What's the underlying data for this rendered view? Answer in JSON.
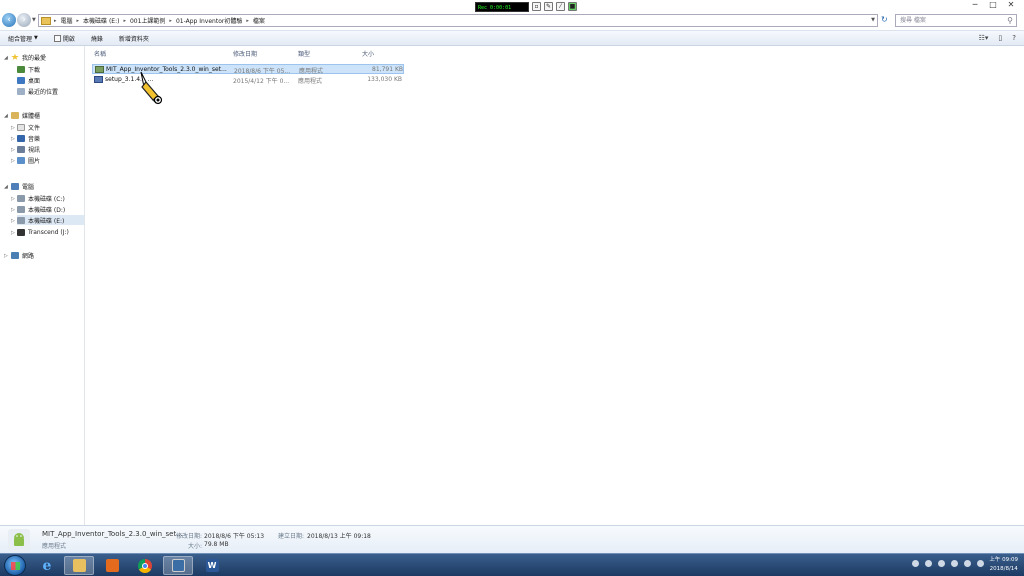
{
  "recorder": {
    "status": "Rec 0:00:01"
  },
  "window": {
    "min": "─",
    "max": "□",
    "close": "✕"
  },
  "address": {
    "crumbs": [
      "電腦",
      "本機磁碟 (E:)",
      "001上課範例",
      "01-App Inventor初體驗",
      "檔案"
    ],
    "search_placeholder": "搜尋 檔案"
  },
  "toolbar": {
    "items": [
      "組合管理",
      "開啟",
      "燒錄",
      "新增資料夾"
    ]
  },
  "nav": {
    "favorites": "我的最愛",
    "downloads": "下載",
    "desktop": "桌面",
    "recent": "最近的位置",
    "libraries": "媒體櫃",
    "documents": "文件",
    "music": "音樂",
    "videos": "視訊",
    "pictures": "圖片",
    "computer": "電腦",
    "drive_c": "本機磁碟 (C:)",
    "drive_d": "本機磁碟 (D:)",
    "drive_e": "本機磁碟 (E:)",
    "drive_j": "Transcend (J:)",
    "network": "網路"
  },
  "columns": {
    "name": "名稱",
    "date": "修改日期",
    "type": "類型",
    "size": "大小"
  },
  "files": [
    {
      "name": "MIT_App_Inventor_Tools_2.3.0_win_set...",
      "date": "2018/8/6 下午 05...",
      "type": "應用程式",
      "size": "81,791 KB"
    },
    {
      "name": "setup_3.1.4... ...",
      "date": "2015/4/12 下午 0...",
      "type": "應用程式",
      "size": "133,030 KB"
    }
  ],
  "details": {
    "filename": "MIT_App_Inventor_Tools_2.3.0_win_set...",
    "filetype": "應用程式",
    "modified_label": "修改日期:",
    "modified": "2018/8/6 下午 05:13",
    "created_label": "建立日期:",
    "created": "2018/8/13 上午 09:18",
    "size_label": "大小:",
    "size": "79.8 MB"
  },
  "clock": {
    "time": "上午 09:09",
    "date": "2018/8/14"
  }
}
